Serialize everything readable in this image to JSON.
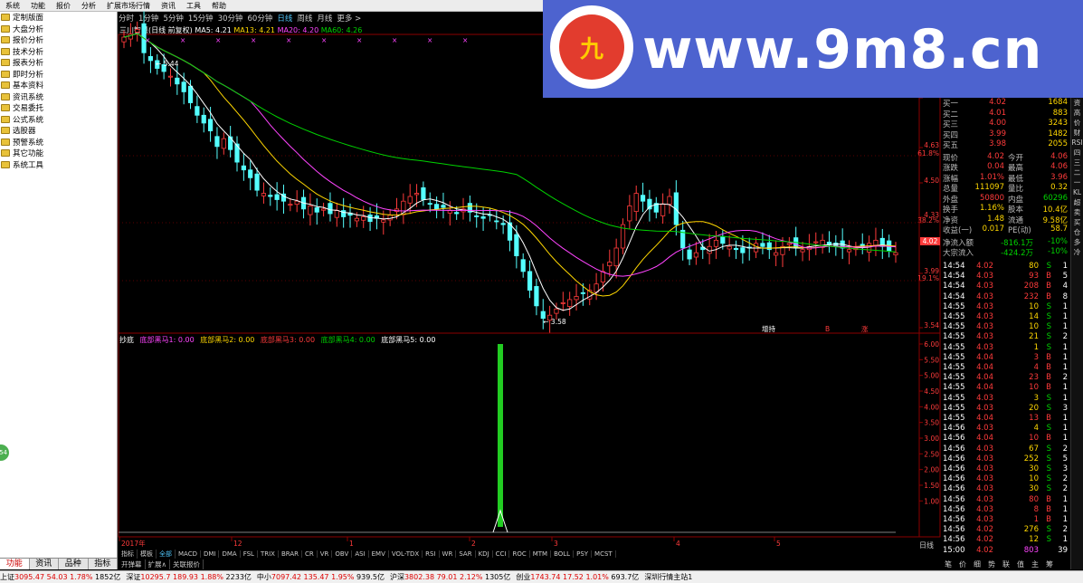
{
  "menubar": {
    "items": [
      "系统",
      "功能",
      "报价",
      "分析",
      "扩展市场行情",
      "资讯",
      "工具",
      "帮助"
    ]
  },
  "sidebar": {
    "items": [
      "定制版面",
      "大盘分析",
      "报价分析",
      "技术分析",
      "报表分析",
      "即时分析",
      "基本资料",
      "资讯系统",
      "交易委托",
      "公式系统",
      "选股器",
      "预警系统",
      "其它功能",
      "系统工具"
    ],
    "badge": "54",
    "tabs": [
      "功能",
      "资讯",
      "品种",
      "指标"
    ]
  },
  "period_bar": {
    "items": [
      "分时",
      "1分钟",
      "5分钟",
      "15分钟",
      "30分钟",
      "60分钟",
      "日线",
      "周线",
      "月线",
      "更多 >"
    ],
    "active": "日线"
  },
  "ma_legend": {
    "title": "三川智慧(日线 前复权)",
    "ma5": "MA5: 4.21",
    "ma13": "MA13: 4.21",
    "ma20": "MA20: 4.20",
    "ma60": "MA60: 4.26"
  },
  "price_axis": [
    "4.80",
    "4.63",
    "61.8%",
    "4.50",
    "4.33",
    "38.2%",
    "3.99",
    "19.1%",
    "3.54"
  ],
  "price_annotations": {
    "high": "5.44",
    "low": "3.58",
    "lastprice": "4.02",
    "marker_left": "增持",
    "marker_mid": "B",
    "marker_right": "涨"
  },
  "time_axis": [
    "2017年",
    "12",
    "1",
    "2",
    "3",
    "4",
    "5"
  ],
  "indicator": {
    "name": "抄底",
    "legend": [
      {
        "text": "底部黑马1: 0.00",
        "color": "#ff44ff"
      },
      {
        "text": "底部黑马2: 0.00",
        "color": "#ffd700"
      },
      {
        "text": "底部黑马3: 0.00",
        "color": "#ff3b3b"
      },
      {
        "text": "底部黑马4: 0.00",
        "color": "#00d200"
      },
      {
        "text": "底部黑马5: 0.00",
        "color": "#ffffff"
      }
    ],
    "axis": [
      "6.00",
      "5.50",
      "5.00",
      "4.50",
      "4.00",
      "3.50",
      "3.00",
      "2.50",
      "2.00",
      "1.50",
      "1.00"
    ],
    "signal_value": 6.0
  },
  "indicator_tabs": {
    "items": [
      "指标",
      "模板",
      "全部",
      "MACD",
      "DMI",
      "DMA",
      "FSL",
      "TRIX",
      "BRAR",
      "CR",
      "VR",
      "OBV",
      "ASI",
      "EMV",
      "VOL-TDX",
      "RSI",
      "WR",
      "SAR",
      "KDJ",
      "CCI",
      "ROC",
      "MTM",
      "BOLL",
      "PSY",
      "MCST"
    ],
    "active": "全部"
  },
  "bottom_tabs": {
    "items": [
      "开弹幕",
      "扩展∧",
      "关联报价"
    ]
  },
  "right_side_tab": "日线",
  "quote": {
    "bid": [
      {
        "label": "买一",
        "price": "4.02",
        "vol": "1684"
      },
      {
        "label": "买二",
        "price": "4.01",
        "vol": "883"
      },
      {
        "label": "买三",
        "price": "4.00",
        "vol": "3243"
      },
      {
        "label": "买四",
        "price": "3.99",
        "vol": "1482"
      },
      {
        "label": "买五",
        "price": "3.98",
        "vol": "2055"
      }
    ],
    "stats": [
      {
        "l1": "现价",
        "v1": "4.02",
        "l2": "今开",
        "v2": "4.06"
      },
      {
        "l1": "涨跌",
        "v1": "0.04",
        "l2": "最高",
        "v2": "4.06"
      },
      {
        "l1": "涨幅",
        "v1": "1.01%",
        "l2": "最低",
        "v2": "3.96"
      },
      {
        "l1": "总量",
        "v1": "111097",
        "l2": "量比",
        "v2": "0.32"
      },
      {
        "l1": "外盘",
        "v1": "50800",
        "l2": "内盘",
        "v2": "60296"
      },
      {
        "l1": "换手",
        "v1": "1.16%",
        "l2": "股本",
        "v2": "10.4亿"
      },
      {
        "l1": "净资",
        "v1": "1.48",
        "l2": "流通",
        "v2": "9.58亿"
      },
      {
        "l1": "收益(一)",
        "v1": "0.017",
        "l2": "PE(动)",
        "v2": "58.7"
      }
    ],
    "flows": [
      {
        "label": "净流入额",
        "value": "-816.1万",
        "pct": "-10%"
      },
      {
        "label": "大宗流入",
        "value": "-424.2万",
        "pct": "-10%"
      }
    ]
  },
  "ticks": [
    {
      "t": "14:54",
      "p": "4.02",
      "v": "80",
      "d": "S",
      "n": "1"
    },
    {
      "t": "14:54",
      "p": "4.03",
      "v": "93",
      "d": "B",
      "n": "5"
    },
    {
      "t": "14:54",
      "p": "4.03",
      "v": "208",
      "d": "B",
      "n": "4"
    },
    {
      "t": "14:54",
      "p": "4.03",
      "v": "232",
      "d": "B",
      "n": "8"
    },
    {
      "t": "14:55",
      "p": "4.03",
      "v": "10",
      "d": "S",
      "n": "1"
    },
    {
      "t": "14:55",
      "p": "4.03",
      "v": "14",
      "d": "S",
      "n": "1"
    },
    {
      "t": "14:55",
      "p": "4.03",
      "v": "10",
      "d": "S",
      "n": "1"
    },
    {
      "t": "14:55",
      "p": "4.03",
      "v": "21",
      "d": "S",
      "n": "2"
    },
    {
      "t": "14:55",
      "p": "4.03",
      "v": "1",
      "d": "S",
      "n": "1"
    },
    {
      "t": "14:55",
      "p": "4.04",
      "v": "3",
      "d": "B",
      "n": "1"
    },
    {
      "t": "14:55",
      "p": "4.04",
      "v": "4",
      "d": "B",
      "n": "1"
    },
    {
      "t": "14:55",
      "p": "4.04",
      "v": "23",
      "d": "B",
      "n": "2"
    },
    {
      "t": "14:55",
      "p": "4.04",
      "v": "10",
      "d": "B",
      "n": "1"
    },
    {
      "t": "14:55",
      "p": "4.03",
      "v": "3",
      "d": "S",
      "n": "1"
    },
    {
      "t": "14:55",
      "p": "4.03",
      "v": "20",
      "d": "S",
      "n": "3"
    },
    {
      "t": "14:55",
      "p": "4.04",
      "v": "13",
      "d": "B",
      "n": "1"
    },
    {
      "t": "14:56",
      "p": "4.03",
      "v": "4",
      "d": "S",
      "n": "1"
    },
    {
      "t": "14:56",
      "p": "4.04",
      "v": "10",
      "d": "B",
      "n": "1"
    },
    {
      "t": "14:56",
      "p": "4.03",
      "v": "67",
      "d": "S",
      "n": "2"
    },
    {
      "t": "14:56",
      "p": "4.03",
      "v": "252",
      "d": "S",
      "n": "5"
    },
    {
      "t": "14:56",
      "p": "4.03",
      "v": "30",
      "d": "S",
      "n": "3"
    },
    {
      "t": "14:56",
      "p": "4.03",
      "v": "10",
      "d": "S",
      "n": "2"
    },
    {
      "t": "14:56",
      "p": "4.03",
      "v": "30",
      "d": "S",
      "n": "2"
    },
    {
      "t": "14:56",
      "p": "4.03",
      "v": "80",
      "d": "B",
      "n": "1"
    },
    {
      "t": "14:56",
      "p": "4.03",
      "v": "8",
      "d": "B",
      "n": "1"
    },
    {
      "t": "14:56",
      "p": "4.03",
      "v": "1",
      "d": "B",
      "n": "1"
    },
    {
      "t": "14:56",
      "p": "4.02",
      "v": "276",
      "d": "S",
      "n": "2"
    },
    {
      "t": "14:56",
      "p": "4.02",
      "v": "12",
      "d": "S",
      "n": "1"
    },
    {
      "t": "15:00",
      "p": "4.02",
      "v": "803",
      "d": "",
      "n": "39"
    }
  ],
  "right_tabs": [
    "笔",
    "价",
    "细",
    "势",
    "联",
    "值",
    "主",
    "筹"
  ],
  "right_scroll": [
    "资",
    "高",
    "价",
    "财",
    "RSI",
    "四",
    "三",
    "二",
    "一",
    "KL",
    "超",
    "卖",
    "买",
    "仓",
    "多",
    "冷"
  ],
  "watermark": {
    "text": "www.9m8.cn",
    "logo": "九"
  },
  "status": {
    "items": [
      {
        "label": "上证",
        "val": "3095.47",
        "chg": "54.03",
        "pct": "1.78%",
        "amt": "1852亿"
      },
      {
        "label": "深证",
        "val": "10295.7",
        "chg": "189.93",
        "pct": "1.88%",
        "amt": "2233亿"
      },
      {
        "label": "中小",
        "val": "7097.42",
        "chg": "135.47",
        "pct": "1.95%",
        "amt": "939.5亿"
      },
      {
        "label": "沪深",
        "val": "3802.38",
        "chg": "79.01",
        "pct": "2.12%",
        "amt": "1305亿"
      },
      {
        "label": "创业",
        "val": "1743.74",
        "chg": "17.52",
        "pct": "1.01%",
        "amt": "693.7亿"
      }
    ],
    "server": "深圳行情主站1"
  },
  "chart_data": {
    "type": "candlestick",
    "price_range": [
      3.54,
      4.8
    ],
    "close": [
      5.4,
      5.42,
      5.45,
      5.3,
      5.25,
      5.2,
      5.18,
      5.15,
      5.1,
      5.05,
      4.98,
      4.9,
      4.85,
      4.8,
      4.7,
      4.75,
      4.68,
      4.6,
      4.55,
      4.5,
      4.42,
      4.4,
      4.38,
      4.36,
      4.35,
      4.33,
      4.35,
      4.3,
      4.32,
      4.28,
      4.3,
      4.27,
      4.29,
      4.25,
      4.26,
      4.24,
      4.25,
      4.22,
      4.24,
      4.23,
      4.26,
      4.3,
      4.35,
      4.38,
      4.4,
      4.36,
      4.33,
      4.3,
      4.31,
      4.29,
      4.27,
      4.3,
      4.28,
      4.25,
      4.24,
      4.26,
      4.22,
      4.2,
      4.1,
      4.0,
      3.9,
      3.78,
      3.68,
      3.6,
      3.62,
      3.66,
      3.7,
      3.72,
      3.74,
      3.76,
      3.78,
      3.82,
      3.9,
      3.96,
      4.05,
      4.2,
      4.32,
      4.4,
      4.35,
      4.3,
      4.28,
      4.33,
      4.38,
      4.2,
      4.05,
      3.98,
      4.02,
      4.04,
      4.06,
      4.1,
      4.08,
      4.06,
      4.04,
      4.02,
      4.05,
      4.08,
      4.06,
      4.04,
      4.02,
      4.06,
      4.08,
      4.05,
      4.04,
      4.06,
      4.09,
      4.1,
      4.07,
      4.06,
      4.05,
      4.04,
      4.05,
      4.06,
      4.08,
      4.1,
      4.06,
      4.03,
      4.02
    ],
    "indicator_signal_index": 61
  }
}
